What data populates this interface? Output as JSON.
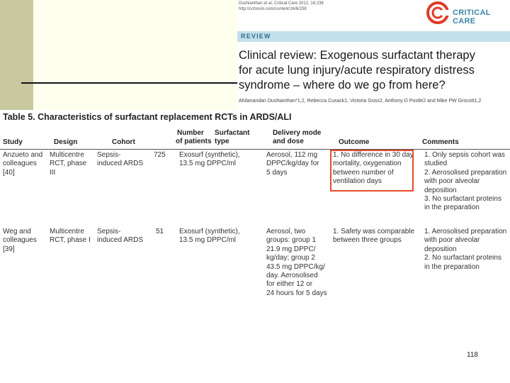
{
  "journal": {
    "citation": "Dushianthan et al. Critical Care 2012, 16:238",
    "url": "http://ccforum.com/content/16/6/238",
    "logo_text": "CRITICAL CARE",
    "section": "REVIEW",
    "title_lines": [
      "Clinical review: Exogenous surfactant therapy",
      "for acute lung injury/acute respiratory distress",
      "syndrome – where do we go from here?"
    ],
    "authors": "Ahilanandan Dushianthan*1,2, Rebecca Cusack1, Victoria Goss2, Anthony D Postle2 and Mike PW Grocott1,2",
    "accent_color": "#3a86a8",
    "logo_color": "#e03a2a"
  },
  "table": {
    "title": "Table 5. Characteristics of surfactant replacement RCTs in ARDS/ALI",
    "headers": {
      "study": "Study",
      "design": "Design",
      "cohort": "Cohort",
      "patients": [
        "Number",
        "of patients"
      ],
      "type": [
        "Surfactant",
        "type"
      ],
      "delivery": [
        "Delivery mode",
        "and dose"
      ],
      "outcome": "Outcome",
      "comments": "Comments"
    },
    "rows": [
      {
        "study": [
          "Anzueto and",
          "colleagues",
          "[40]"
        ],
        "design": [
          "Multicentre",
          "RCT, phase",
          "III"
        ],
        "cohort": [
          "Sepsis-",
          "induced ARDS"
        ],
        "patients": "725",
        "type": [
          "Exosurf (synthetic),",
          "13.5 mg DPPC/ml"
        ],
        "delivery": [
          "Aerosol, 112 mg",
          "DPPC/kg/day for",
          "5 days"
        ],
        "outcome": [
          "1. No difference in 30 day",
          "mortality, oxygenation",
          "between number of",
          "ventilation days"
        ],
        "comments": [
          "1. Only sepsis cohort was",
          "studied",
          "2. Aerosolised preparation",
          "with poor alveolar",
          "deposition",
          "3. No surfactant proteins",
          "in the preparation"
        ]
      },
      {
        "study": [
          "Weg and",
          "colleagues",
          "[39]"
        ],
        "design": [
          "Multicentre",
          "RCT, phase I"
        ],
        "cohort": [
          "Sepsis-",
          "induced ARDS"
        ],
        "patients": "51",
        "type": [
          "Exosurf (synthetic),",
          "13.5 mg DPPC/ml"
        ],
        "delivery": [
          "Aerosol, two",
          "groups: group 1",
          "21.9 mg DPPC/",
          "kg/day; group 2",
          "43.5 mg DPPC/kg/",
          "day. Aerosolised",
          "for either 12 or",
          "24 hours for 5 days"
        ],
        "outcome": [
          "1. Safety was comparable",
          "between three groups"
        ],
        "comments": [
          "1. Aerosolised preparation",
          "with poor alveolar",
          "deposition",
          "2. No surfactant proteins",
          "in the preparation"
        ]
      }
    ],
    "highlight_color": "#e84a2a"
  },
  "page_number": "118"
}
